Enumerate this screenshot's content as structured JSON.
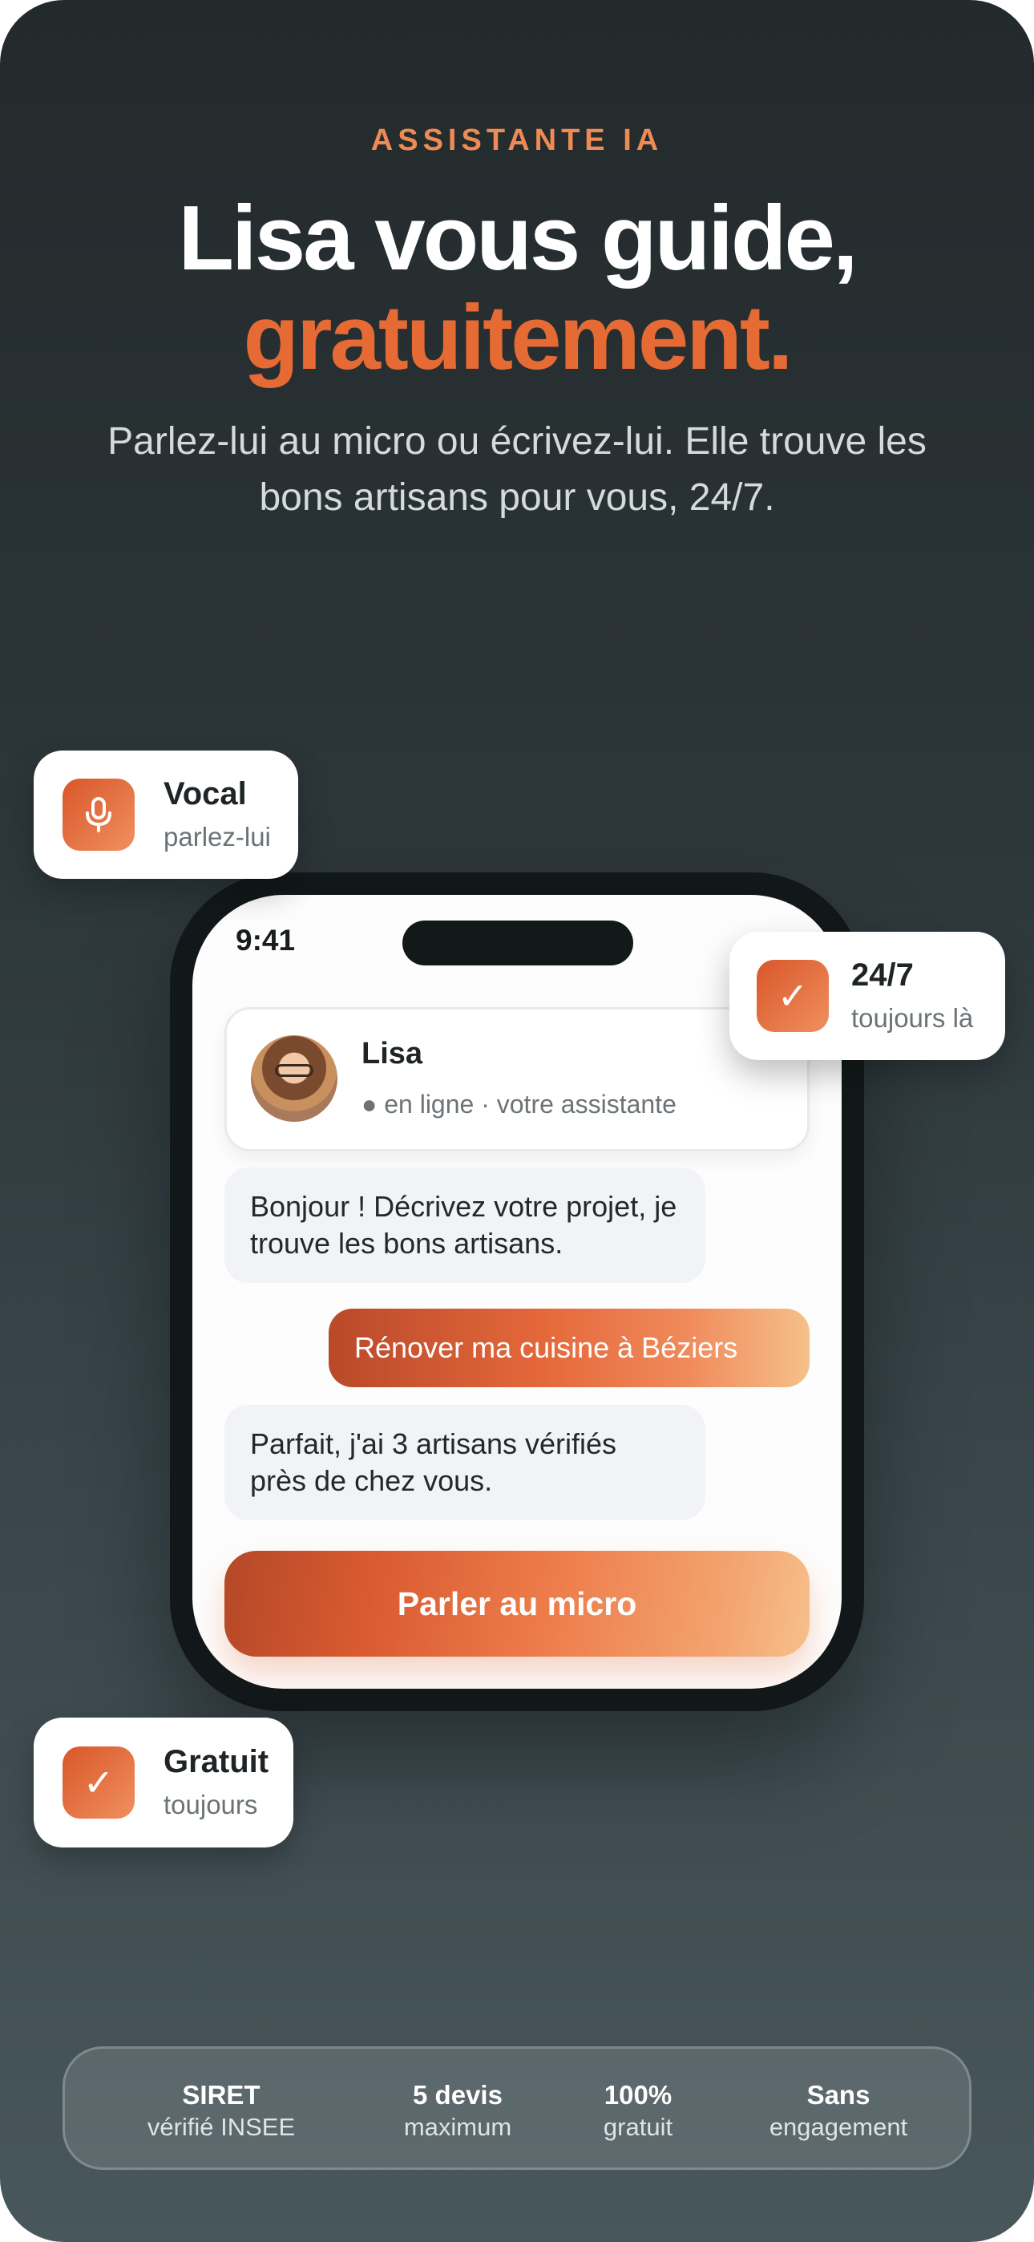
{
  "hero": {
    "eyebrow": "ASSISTANTE IA",
    "headline_line1": "Lisa vous guide,",
    "headline_line2": "gratuitement.",
    "subtitle": "Parlez-lui au micro ou écrivez-lui. Elle trouve les bons artisans pour vous, 24/7."
  },
  "badges": {
    "vocal": {
      "title": "Vocal",
      "subtitle": "parlez-lui",
      "icon": "microphone-icon"
    },
    "always": {
      "title": "24/7",
      "subtitle": "toujours là",
      "icon": "check-icon"
    },
    "free": {
      "title": "Gratuit",
      "subtitle": "toujours",
      "icon": "check-icon"
    }
  },
  "phone": {
    "status_time": "9:41",
    "contact": {
      "name": "Lisa",
      "status": "● en ligne · votre assistante"
    },
    "messages": [
      {
        "from": "assistant",
        "text": "Bonjour ! Décrivez votre projet, je trouve les bons artisans."
      },
      {
        "from": "user",
        "text": "Rénover ma cuisine à Béziers"
      },
      {
        "from": "assistant",
        "text": "Parfait, j'ai 3 artisans vérifiés près de chez vous."
      }
    ],
    "cta_label": "Parler au micro"
  },
  "stats": [
    {
      "value": "SIRET",
      "label": "vérifié INSEE"
    },
    {
      "value": "5 devis",
      "label": "maximum"
    },
    {
      "value": "100%",
      "label": "gratuit"
    },
    {
      "value": "Sans",
      "label": "engagement"
    }
  ],
  "colors": {
    "accent": "#e56a34",
    "eyebrow": "#ef8a55",
    "background_top": "#232a2c",
    "background_bottom": "#48575b"
  }
}
